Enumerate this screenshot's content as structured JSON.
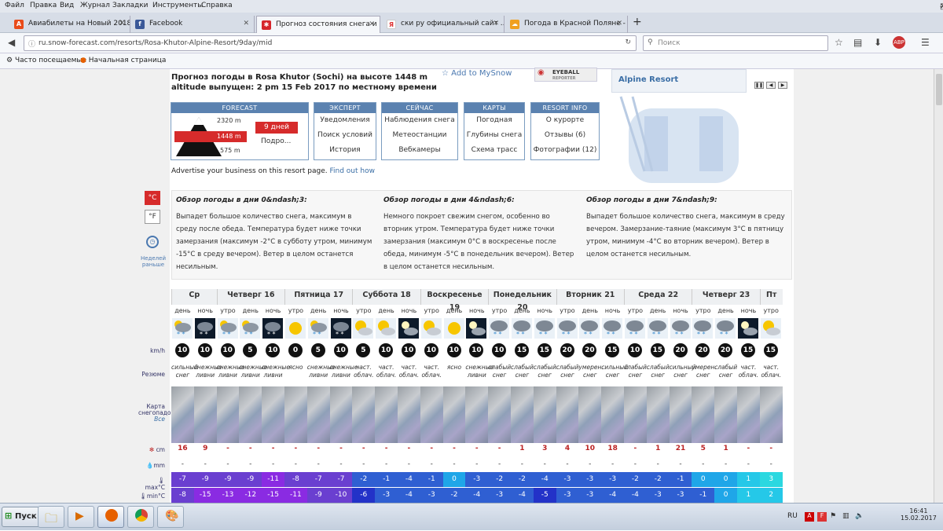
{
  "browser": {
    "menu": [
      "Файл",
      "Правка",
      "Вид",
      "Журнал",
      "Закладки",
      "Инструменты",
      "Справка"
    ],
    "tabs": [
      {
        "label": "Авиабилеты на Новый 2018..."
      },
      {
        "label": "Facebook"
      },
      {
        "label": "Прогноз состояния снега и ..."
      },
      {
        "label": "ски ру официальный сайт ..."
      },
      {
        "label": "Погода в Красной Поляне - ..."
      }
    ],
    "url": "ru.snow-forecast.com/resorts/Rosa-Khutor-Alpine-Resort/9day/mid",
    "search_placeholder": "Поиск",
    "bookmarks": [
      "Часто посещаемые",
      "Начальная страница"
    ]
  },
  "page": {
    "title": "Прогноз погоды в Rosa Khutor (Sochi) на высоте 1448 m",
    "issued": "altitude выпущен: 2 pm  15 Feb 2017 по местному времени",
    "add_to_mysnow": "Add to MySnow",
    "eyeball": "EYEBALL",
    "eyeball_sub": "REPORTER",
    "sidepanel_link": "Alpine Resort",
    "advertise": "Advertise your business on this resort page.",
    "advertise_link": "Find out how",
    "forecast_box": {
      "header": "FORECAST",
      "elevations": [
        "2320 m",
        "1448 m",
        "575 m"
      ],
      "days_button": "9 дней",
      "more": "Подро..."
    },
    "menus": [
      {
        "header": "ЭКСПЕРТ",
        "items": [
          "Уведомления",
          "Поиск условий",
          "История"
        ]
      },
      {
        "header": "СЕЙЧАС",
        "items": [
          "Наблюдения снега",
          "Метеостанции",
          "Вебкамеры"
        ]
      },
      {
        "header": "КАРТЫ",
        "items": [
          "Погодная",
          "Глубины снега",
          "Схема трасс"
        ]
      },
      {
        "header": "RESORT INFO",
        "items": [
          "О курорте",
          "Отзывы (6)",
          "Фотографии (12)"
        ]
      }
    ],
    "units": {
      "c": "°C",
      "f": "°F"
    },
    "earlier": "Неделей раньше",
    "summaries": [
      {
        "title": "Обзор погоды в дни 0&ndash;3:",
        "text": "Выпадет большое количество снега, максимум в среду после обеда. Температура будет ниже точки замерзания (максимум -2°C в субботу утром, минимум -15°C в среду вечером). Ветер в целом останется несильным."
      },
      {
        "title": "Обзор погоды в дни 4&ndash;6:",
        "text": "Немного покроет свежим снегом, особенно во вторник утром. Температура будет ниже точки замерзания (максимум 0°C в воскресенье после обеда, минимум -5°C в понедельник вечером). Ветер в целом останется несильным."
      },
      {
        "title": "Обзор погоды в дни 7&ndash;9:",
        "text": "Выпадет большое количество снега, максимум в среду вечером. Замерзание-таяние (максимум 3°C в пятницу утром, минимум -4°C во вторник вечером). Ветер в целом останется несильным."
      }
    ],
    "row_labels": {
      "wind": "km/h",
      "summary": "Резюме",
      "map": "Карта снегопадов",
      "map_all": "Все",
      "snow": "cm",
      "rain": "mm",
      "max": "max°C",
      "min": "min°C"
    },
    "days": [
      {
        "name": "Ср",
        "periods": [
          "день",
          "ночь"
        ]
      },
      {
        "name": "Четверг 16",
        "periods": [
          "утро",
          "день",
          "ночь"
        ]
      },
      {
        "name": "Пятница 17",
        "periods": [
          "утро",
          "день",
          "ночь"
        ]
      },
      {
        "name": "Суббота 18",
        "periods": [
          "утро",
          "день",
          "ночь"
        ]
      },
      {
        "name": "Воскресенье 19",
        "periods": [
          "утро",
          "день",
          "ночь"
        ]
      },
      {
        "name": "Понедельник 20",
        "periods": [
          "утро",
          "день",
          "ночь"
        ]
      },
      {
        "name": "Вторник 21",
        "periods": [
          "утро",
          "день",
          "ночь"
        ]
      },
      {
        "name": "Среда 22",
        "periods": [
          "утро",
          "день",
          "ночь"
        ]
      },
      {
        "name": "Четверг 23",
        "periods": [
          "утро",
          "день",
          "ночь"
        ]
      },
      {
        "name": "Пт",
        "periods": [
          "утро"
        ]
      }
    ],
    "cells": [
      {
        "icon": "snow",
        "wind": "10",
        "cond": "сильный снег",
        "snow": "16",
        "rain": "-",
        "max": "-7",
        "min": "-8"
      },
      {
        "icon": "snow-night",
        "wind": "10",
        "cond": "снежные ливни",
        "snow": "9",
        "rain": "-",
        "max": "-9",
        "min": "-15"
      },
      {
        "icon": "snow",
        "wind": "10",
        "cond": "снежные ливни",
        "snow": "-",
        "rain": "-",
        "max": "-9",
        "min": "-13"
      },
      {
        "icon": "snow",
        "wind": "5",
        "cond": "снежные ливни",
        "snow": "-",
        "rain": "-",
        "max": "-9",
        "min": "-12"
      },
      {
        "icon": "snow-night",
        "wind": "10",
        "cond": "снежные ливни",
        "snow": "-",
        "rain": "-",
        "max": "-11",
        "min": "-15"
      },
      {
        "icon": "sun",
        "wind": "0",
        "cond": "ясно",
        "snow": "-",
        "rain": "-",
        "max": "-8",
        "min": "-11"
      },
      {
        "icon": "snow",
        "wind": "5",
        "cond": "снежные ливни",
        "snow": "-",
        "rain": "-",
        "max": "-7",
        "min": "-9"
      },
      {
        "icon": "snow-night",
        "wind": "10",
        "cond": "снежные ливни",
        "snow": "-",
        "rain": "-",
        "max": "-7",
        "min": "-10"
      },
      {
        "icon": "partsun",
        "wind": "5",
        "cond": "част. облач.",
        "snow": "-",
        "rain": "-",
        "max": "-2",
        "min": "-6"
      },
      {
        "icon": "partsun",
        "wind": "10",
        "cond": "част. облач.",
        "snow": "-",
        "rain": "-",
        "max": "-1",
        "min": "-3"
      },
      {
        "icon": "partnight",
        "wind": "10",
        "cond": "част. облач.",
        "snow": "-",
        "rain": "-",
        "max": "-4",
        "min": "-4"
      },
      {
        "icon": "partsun",
        "wind": "10",
        "cond": "част. облач.",
        "snow": "-",
        "rain": "-",
        "max": "-1",
        "min": "-3"
      },
      {
        "icon": "sun",
        "wind": "10",
        "cond": "ясно",
        "snow": "-",
        "rain": "-",
        "max": "0",
        "min": "-2"
      },
      {
        "icon": "partnight",
        "wind": "10",
        "cond": "снежные ливни",
        "snow": "-",
        "rain": "-",
        "max": "-3",
        "min": "-4"
      },
      {
        "icon": "cloudsnow",
        "wind": "10",
        "cond": "слабый снег",
        "snow": "-",
        "rain": "-",
        "max": "-2",
        "min": "-3"
      },
      {
        "icon": "cloudsnow",
        "wind": "15",
        "cond": "слабый снег",
        "snow": "1",
        "rain": "-",
        "max": "-2",
        "min": "-4"
      },
      {
        "icon": "cloudsnow",
        "wind": "15",
        "cond": "слабый снег",
        "snow": "3",
        "rain": "-",
        "max": "-4",
        "min": "-5"
      },
      {
        "icon": "cloudsnow",
        "wind": "20",
        "cond": "слабый снег",
        "snow": "4",
        "rain": "-",
        "max": "-3",
        "min": "-3"
      },
      {
        "icon": "cloudsnow",
        "wind": "20",
        "cond": "умерен. снег",
        "snow": "10",
        "rain": "-",
        "max": "-3",
        "min": "-3"
      },
      {
        "icon": "cloudsnow",
        "wind": "15",
        "cond": "сильный снег",
        "snow": "18",
        "rain": "-",
        "max": "-3",
        "min": "-4"
      },
      {
        "icon": "cloudsnow",
        "wind": "10",
        "cond": "слабый снег",
        "snow": "-",
        "rain": "-",
        "max": "-2",
        "min": "-4"
      },
      {
        "icon": "cloudsnow",
        "wind": "15",
        "cond": "слабый снег",
        "snow": "1",
        "rain": "-",
        "max": "-2",
        "min": "-3"
      },
      {
        "icon": "cloudsnow",
        "wind": "20",
        "cond": "сильный снег",
        "snow": "21",
        "rain": "-",
        "max": "-1",
        "min": "-3"
      },
      {
        "icon": "cloudsnow",
        "wind": "20",
        "cond": "умерен. снег",
        "snow": "5",
        "rain": "-",
        "max": "0",
        "min": "-1"
      },
      {
        "icon": "cloudsnow",
        "wind": "20",
        "cond": "слабый снег",
        "snow": "1",
        "rain": "-",
        "max": "0",
        "min": "0"
      },
      {
        "icon": "partnight",
        "wind": "15",
        "cond": "част. облач.",
        "snow": "-",
        "rain": "-",
        "max": "1",
        "min": "1"
      },
      {
        "icon": "partsun",
        "wind": "15",
        "cond": "част. облач.",
        "snow": "-",
        "rain": "-",
        "max": "3",
        "min": "2"
      }
    ]
  },
  "taskbar": {
    "start": "Пуск",
    "lang": "RU",
    "time": "16:41",
    "date": "15.02.2017"
  },
  "colors": {
    "header_blue": "#5b82b0",
    "red_button": "#d62b2b",
    "snow_red": "#b22222"
  }
}
